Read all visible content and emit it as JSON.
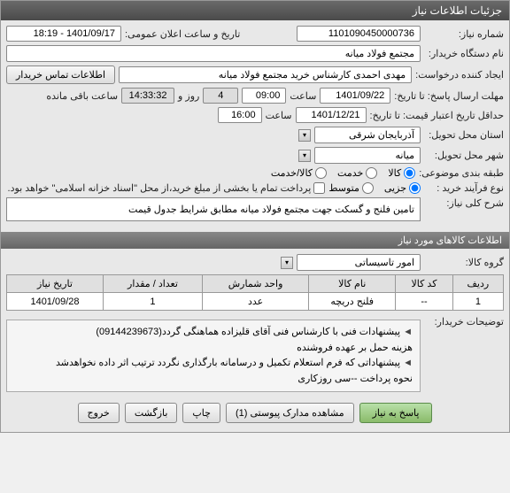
{
  "titlebar": "جزئیات اطلاعات نیاز",
  "fields": {
    "need_no_label": "شماره نیاز:",
    "need_no": "1101090450000736",
    "announce_label": "تاریخ و ساعت اعلان عمومی:",
    "announce": "1401/09/17 - 18:19",
    "buyer_label": "نام دستگاه خریدار:",
    "buyer": "مجتمع فولاد میانه",
    "requester_label": "ایجاد کننده درخواست:",
    "requester": "مهدی احمدی کارشناس خرید مجتمع فولاد میانه",
    "contact_btn": "اطلاعات تماس خریدار",
    "deadline_label": "مهلت ارسال پاسخ: تا تاریخ:",
    "deadline_date": "1401/09/22",
    "time_label": "ساعت",
    "deadline_time": "09:00",
    "days": "4",
    "days_label": "روز و",
    "remain_time": "14:33:32",
    "remain_label": "ساعت باقی مانده",
    "validity_label": "حداقل تاریخ اعتبار قیمت: تا تاریخ:",
    "validity_date": "1401/12/21",
    "validity_time": "16:00",
    "province_label": "استان محل تحویل:",
    "province": "آذربایجان شرقی",
    "city_label": "شهر محل تحویل:",
    "city": "میانه",
    "category_label": "طبقه بندی موضوعی:",
    "cat_goods": "کالا",
    "cat_service": "خدمت",
    "cat_goods_service": "کالا/خدمت",
    "process_label": "نوع فرآیند خرید :",
    "proc_partial": "جزیی",
    "proc_medium": "متوسط",
    "process_note": "پرداخت تمام یا بخشی از مبلغ خرید،از محل \"اسناد خزانه اسلامی\" خواهد بود.",
    "desc_label": "شرح کلی نیاز:",
    "desc": "تامین فلنج و گسکت  جهت مجتمع فولاد میانه مطابق شرایط جدول قیمت",
    "section2": "اطلاعات کالاهای مورد نیاز",
    "group_label": "گروه کالا:",
    "group": "امور تاسیساتی",
    "buyer_notes_label": "توضیحات خریدار:",
    "notes": [
      "پیشنهادات فنی با کارشناس فنی آقای قلیزاده هماهنگی گردد(09144239673)",
      "هزینه حمل بر عهده فروشنده",
      "پیشنهاداتی که فرم استعلام تکمیل و درسامانه بارگذاری نگردد ترتیب اثر داده نخواهدشد",
      "نحوه پرداخت --سی روزکاری"
    ]
  },
  "table": {
    "headers": [
      "ردیف",
      "کد کالا",
      "نام کالا",
      "واحد شمارش",
      "تعداد / مقدار",
      "تاریخ نیاز"
    ],
    "row": [
      "1",
      "--",
      "فلنج دریچه",
      "عدد",
      "1",
      "1401/09/28"
    ]
  },
  "footer": {
    "respond": "پاسخ به نیاز",
    "attachments": "مشاهده مدارک پیوستی (1)",
    "print": "چاپ",
    "back": "بازگشت",
    "exit": "خروج"
  }
}
